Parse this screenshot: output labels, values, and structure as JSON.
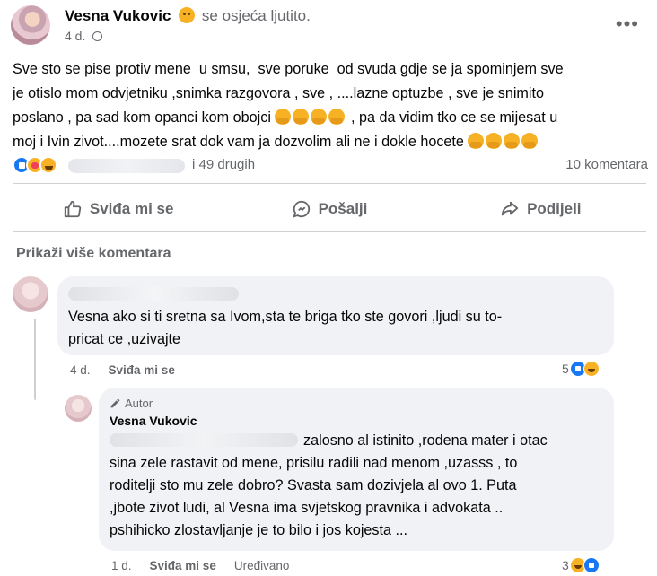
{
  "post": {
    "author": "Vesna Vukovic",
    "feeling": "se osjeća ljutito.",
    "time": "4 d.",
    "more_icon": "ellipsis-icon",
    "text_lines": [
      "Sve sto se pise protiv mene  u smsu,  sve poruke  od svuda gdje se ja spominjem sve",
      "je otislo mom odvjetniku ,snimka razgovora , sve , ....lazne optuzbe , sve je snimito",
      "poslano , pa sad kom opanci kom obojci",
      ", pa da vidim tko ce se mijesat u",
      "moj i Ivin zivot....mozete srat dok vam ja dozvolim ali ne i dokle hocete"
    ]
  },
  "stats": {
    "reactions": [
      "like",
      "care",
      "haha"
    ],
    "others": "i 49 drugih",
    "comments": "10 komentara"
  },
  "actions": {
    "like": "Sviđa mi se",
    "send": "Pošalji",
    "share": "Podijeli"
  },
  "comments": {
    "show_more": "Prikaži više komentara",
    "first": {
      "text": "Vesna ako si ti sretna sa Ivom,sta te briga tko ste govori ,ljudi su to-\npricat ce ,uzivajte",
      "time": "4 d.",
      "like_label": "Sviđa mi se",
      "reaction_count": "5"
    },
    "reply": {
      "badge": "Autor",
      "name": "Vesna Vukovic",
      "text_first": "zalosno al istinito ,rodena mater i otac",
      "text_rest": "sina zele rastavit od mene, prisilu radili nad menom ,uzasss , to\nroditelji sto mu zele dobro? Svasta sam dozivjela al ovo 1. Puta\n,jbote zivot ludi, al Vesna ima svjetskog pravnika i advokata ..\npshihicko zlostavljanje je to bilo i jos kojesta ...",
      "time": "1 d.",
      "like_label": "Sviđa mi se",
      "edited": "Uređivano",
      "reaction_count": "3"
    }
  }
}
